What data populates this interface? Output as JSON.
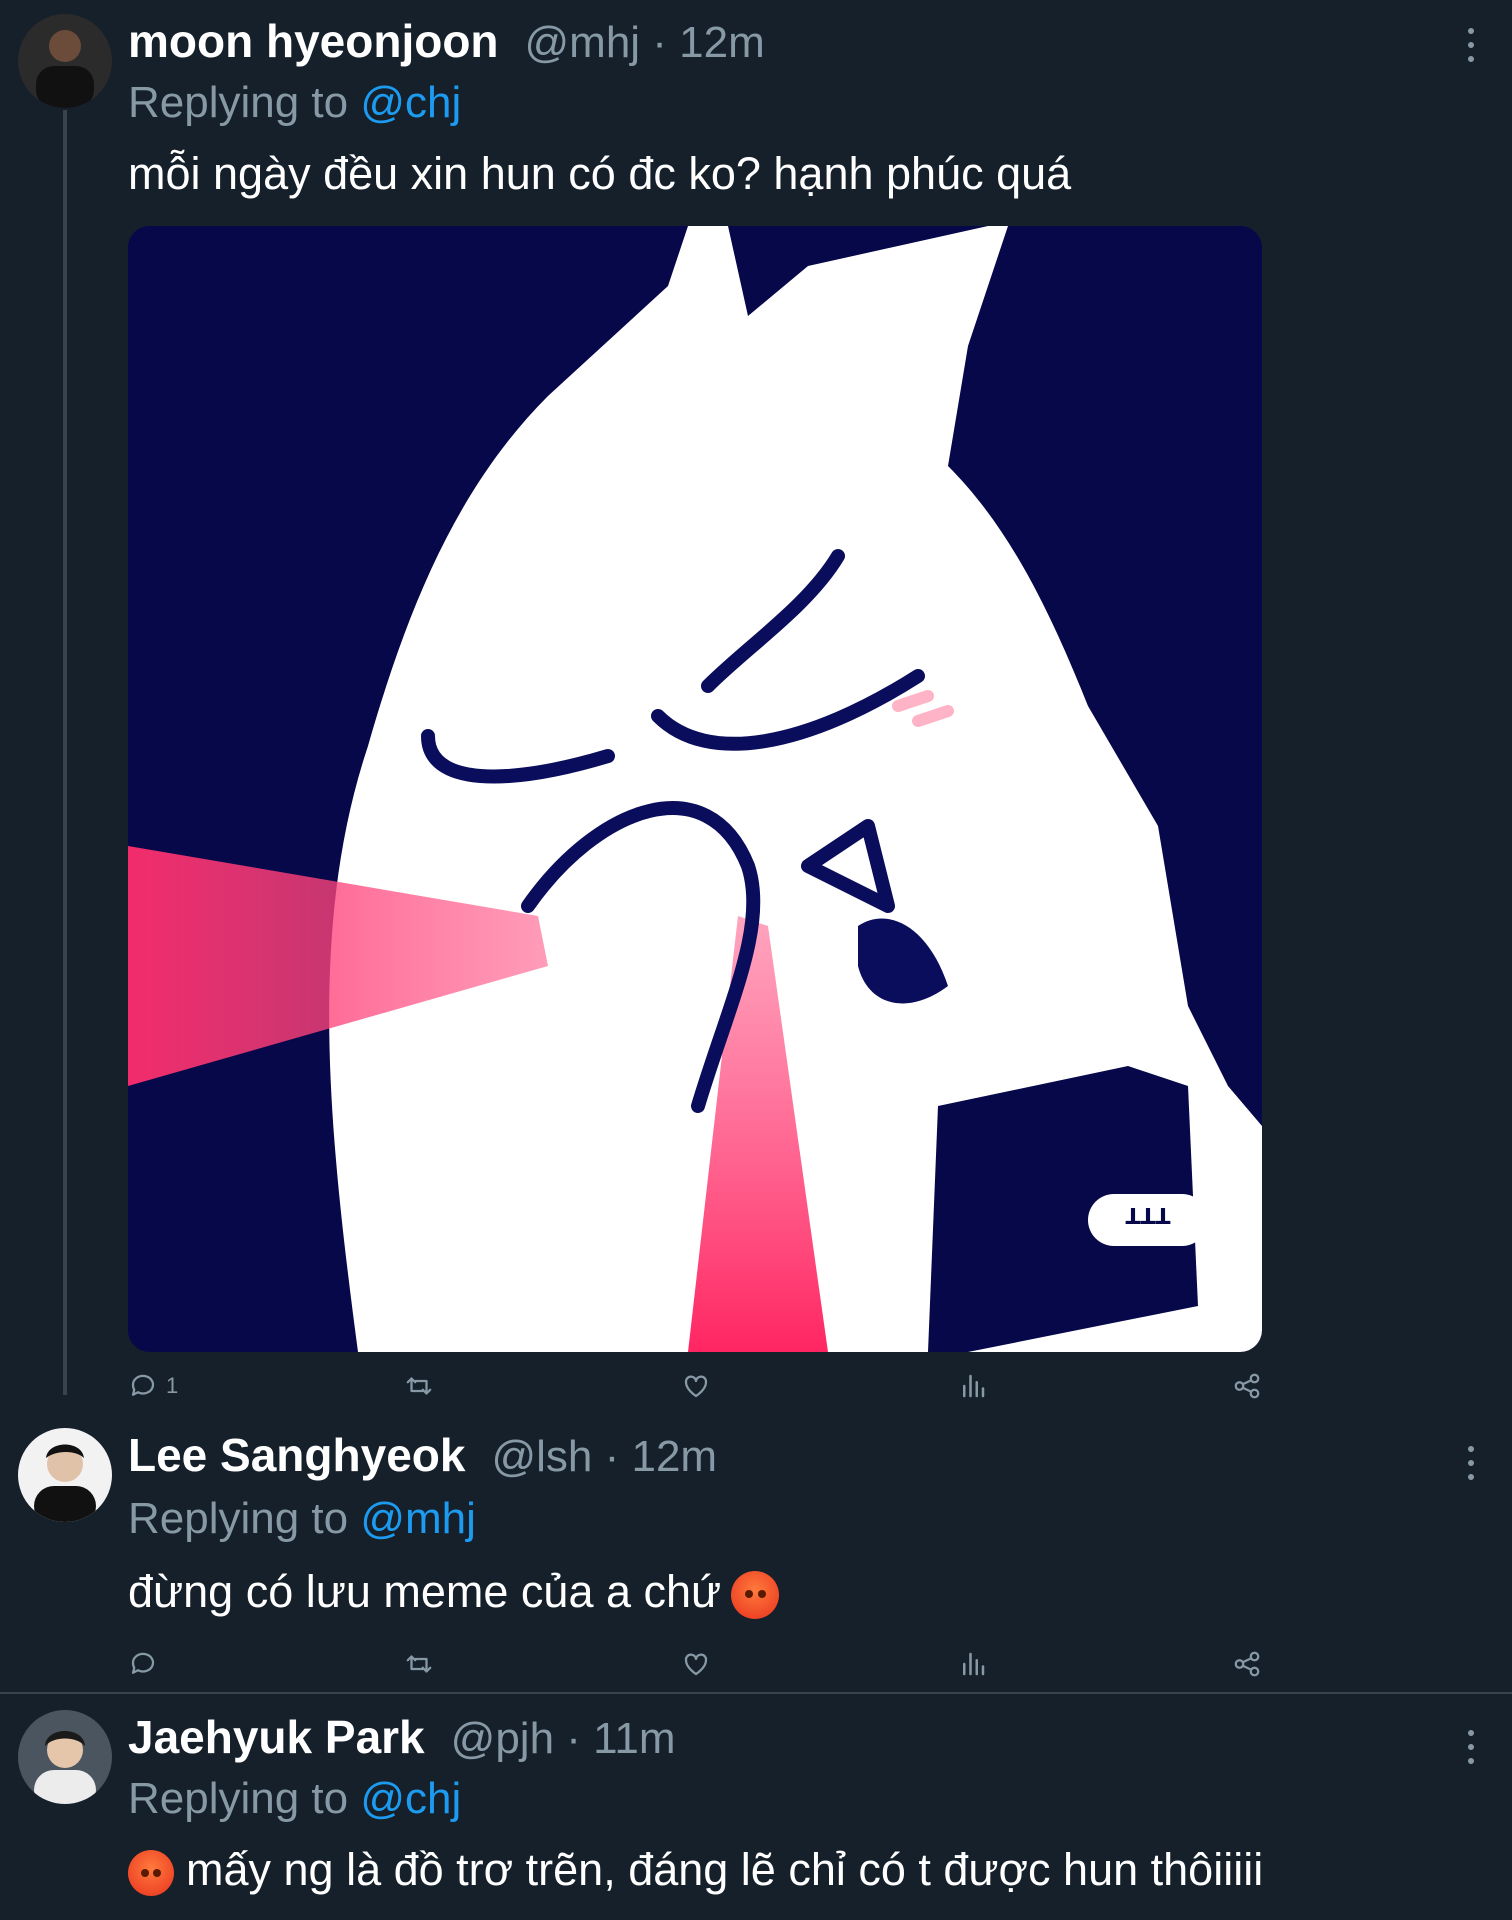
{
  "tweets": [
    {
      "name": "moon hyeonjoon",
      "handle": "@mhj · 12m",
      "replying_prefix": "Replying to ",
      "replying_to": "@chj",
      "text": "mỗi ngày đều xin  hun có đc ko? hạnh phúc quá",
      "has_media": true,
      "actions": {
        "reply_count": "1",
        "retweet_count": "",
        "like_count": ""
      }
    },
    {
      "name": "Lee Sanghyeok",
      "handle": "@lsh · 12m",
      "replying_prefix": "Replying to ",
      "replying_to": "@mhj",
      "text": "đừng có lưu meme của a chứ",
      "emoji": "angry-face",
      "actions": {
        "reply_count": "",
        "retweet_count": "",
        "like_count": ""
      }
    },
    {
      "name": "Jaehyuk Park",
      "handle": "@pjh · 11m",
      "replying_prefix": "Replying to ",
      "replying_to": "@chj",
      "text": "mấy ng là đồ trơ trẽn, đáng lẽ chỉ có t được hun thôiiiii",
      "emoji": "cursing-face"
    }
  ],
  "media": {
    "sticker_text": "ꓕꓕꓕ"
  },
  "colors": {
    "background": "#15202b",
    "secondary_text": "#8899a6",
    "mention": "#1d9bf0",
    "divider": "#38444d"
  },
  "icons": [
    "reply-icon",
    "retweet-icon",
    "like-icon",
    "analytics-icon",
    "share-icon",
    "more-icon"
  ]
}
